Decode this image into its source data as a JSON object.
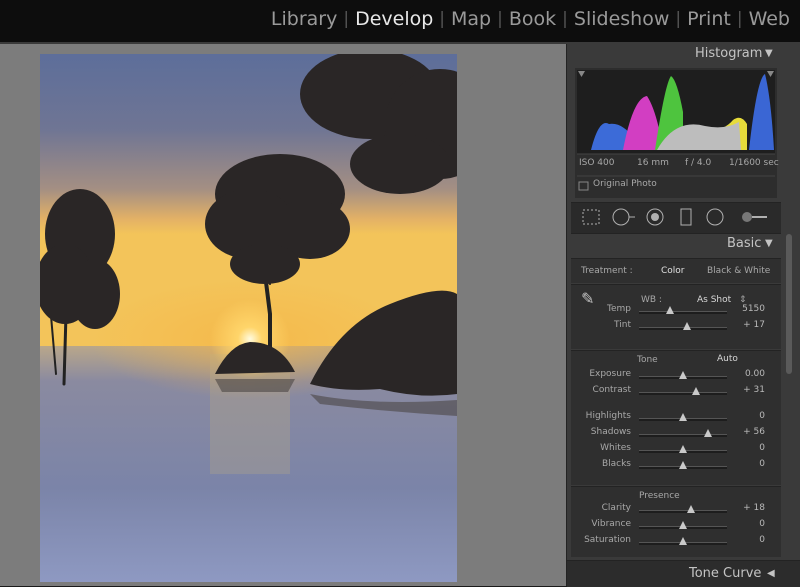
{
  "modules": [
    "Library",
    "Develop",
    "Map",
    "Book",
    "Slideshow",
    "Print",
    "Web"
  ],
  "active_module": "Develop",
  "histogram": {
    "title": "Histogram",
    "iso": "ISO 400",
    "focal": "16 mm",
    "aperture": "f / 4.0",
    "shutter": "1/1600 sec",
    "original_label": "Original Photo"
  },
  "basic": {
    "title": "Basic",
    "treatment_label": "Treatment :",
    "treatment_color": "Color",
    "treatment_bw": "Black & White",
    "wb_label": "WB :",
    "wb_value": "As Shot",
    "tone_label": "Tone",
    "auto_label": "Auto",
    "presence_label": "Presence",
    "sliders": [
      {
        "label": "Temp",
        "value": "5150",
        "pos": 0.35
      },
      {
        "label": "Tint",
        "value": "+ 17",
        "pos": 0.55
      },
      {
        "label": "Exposure",
        "value": "0.00",
        "pos": 0.5
      },
      {
        "label": "Contrast",
        "value": "+ 31",
        "pos": 0.65
      },
      {
        "label": "Highlights",
        "value": "0",
        "pos": 0.5
      },
      {
        "label": "Shadows",
        "value": "+ 56",
        "pos": 0.78
      },
      {
        "label": "Whites",
        "value": "0",
        "pos": 0.5
      },
      {
        "label": "Blacks",
        "value": "0",
        "pos": 0.5
      },
      {
        "label": "Clarity",
        "value": "+ 18",
        "pos": 0.59
      },
      {
        "label": "Vibrance",
        "value": "0",
        "pos": 0.5
      },
      {
        "label": "Saturation",
        "value": "0",
        "pos": 0.5
      }
    ]
  },
  "tone_curve": {
    "title": "Tone Curve"
  },
  "colors": {
    "canvas": "#7c7c7c",
    "panel": "#3a3a3a",
    "topbar": "#0d0d0d",
    "active": "#e8e8e8"
  }
}
